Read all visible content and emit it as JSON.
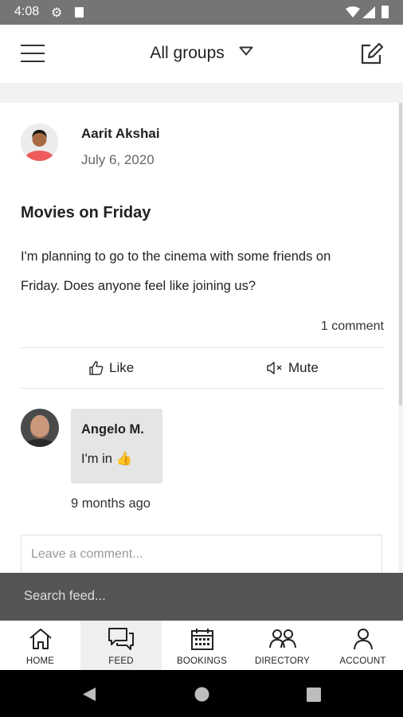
{
  "status_bar": {
    "time": "4:08"
  },
  "header": {
    "title": "All groups"
  },
  "post": {
    "author": "Aarit Akshai",
    "date": "July 6, 2020",
    "title": "Movies on Friday",
    "body_line1": "I'm planning to go to the cinema with some friends on",
    "body_line2": "Friday. Does anyone feel like joining us?",
    "comment_count": "1 comment",
    "like_label": "Like",
    "mute_label": "Mute"
  },
  "comment": {
    "author": "Angelo M.",
    "text": "I'm in",
    "emoji": "👍",
    "time": "9 months ago"
  },
  "comment_input": {
    "placeholder": "Leave a comment..."
  },
  "search": {
    "placeholder": "Search feed..."
  },
  "bottom_nav": {
    "items": [
      {
        "label": "HOME",
        "icon": "home-icon"
      },
      {
        "label": "FEED",
        "icon": "feed-icon",
        "active": true
      },
      {
        "label": "BOOKINGS",
        "icon": "calendar-icon"
      },
      {
        "label": "DIRECTORY",
        "icon": "people-icon"
      },
      {
        "label": "ACCOUNT",
        "icon": "person-icon"
      }
    ]
  },
  "colors": {
    "search_bar": "#555555",
    "nav_active_bg": "#efefef",
    "status_bar": "#757575"
  }
}
